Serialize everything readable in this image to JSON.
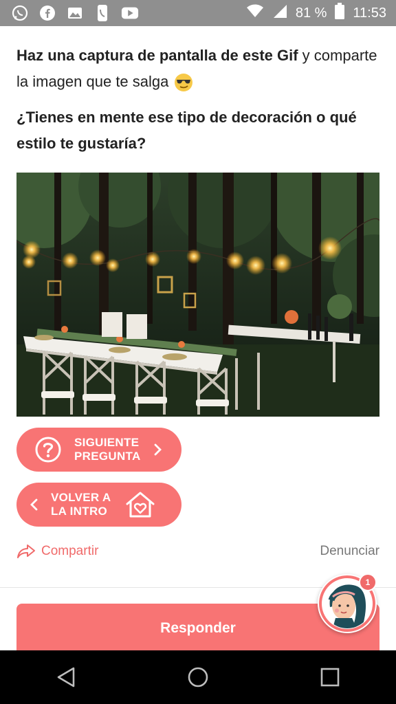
{
  "status_bar": {
    "battery": "81 %",
    "time": "11:53",
    "icons": [
      "whatsapp-icon",
      "facebook-icon",
      "gallery-icon",
      "phone-icon",
      "youtube-icon",
      "wifi-icon",
      "signal-icon",
      "battery-icon"
    ],
    "bg_color": "#8f8f8f"
  },
  "question": {
    "line_bold": "Haz una captura de pantalla de este Gif",
    "line_rest": " y comparte la imagen que te salga",
    "emoji": "sunglasses-emoji",
    "prompt": "¿Tienes en mente ese tipo de decoración o qué estilo te gustaría?"
  },
  "image": {
    "subject": "outdoor-forest-wedding-table-with-string-lights"
  },
  "buttons": {
    "next_line1": "SIGUIENTE",
    "next_line2": "PREGUNTA",
    "back_line1": "VOLVER A",
    "back_line2": "LA INTRO",
    "accent": "#f87474"
  },
  "links": {
    "share": "Compartir",
    "report": "Denunciar"
  },
  "reply": {
    "label": "Responder"
  },
  "assistant": {
    "badge": "1"
  }
}
